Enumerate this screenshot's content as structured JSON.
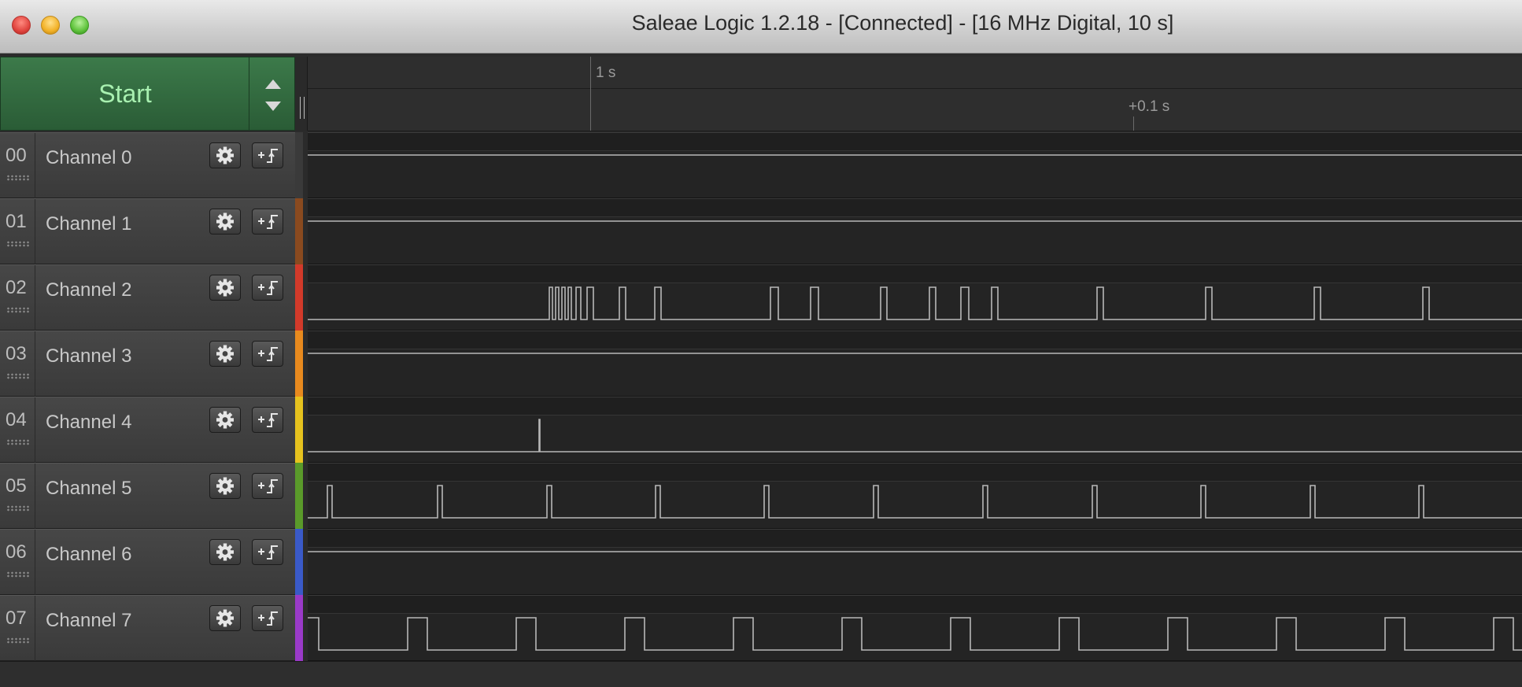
{
  "window": {
    "title": "Saleae Logic 1.2.18 - [Connected] - [16 MHz Digital, 10 s]"
  },
  "start_button": {
    "label": "Start"
  },
  "ruler": {
    "labels": [
      "1 s",
      "+0.1 s"
    ]
  },
  "channels": [
    {
      "index": "00",
      "name": "Channel 0",
      "color": "#3a3a3a",
      "level": "high",
      "edges": []
    },
    {
      "index": "01",
      "name": "Channel 1",
      "color": "#8a4a1f",
      "level": "high",
      "edges": []
    },
    {
      "index": "02",
      "name": "Channel 2",
      "color": "#d23a2a",
      "level": "low",
      "edges": [
        307,
        311,
        315,
        319,
        323,
        327,
        331,
        335,
        341,
        347,
        355,
        363,
        396,
        404,
        441,
        449,
        588,
        598,
        639,
        649,
        728,
        736,
        790,
        798,
        830,
        840,
        869,
        877,
        1003,
        1011,
        1141,
        1149,
        1279,
        1287,
        1417,
        1425
      ]
    },
    {
      "index": "03",
      "name": "Channel 3",
      "color": "#e88a1e",
      "level": "high",
      "edges": []
    },
    {
      "index": "04",
      "name": "Channel 4",
      "color": "#e6c21e",
      "level": "low",
      "edges": [
        294,
        295
      ]
    },
    {
      "index": "05",
      "name": "Channel 5",
      "color": "#5a9a2a",
      "level": "low",
      "edges": [
        25,
        31,
        165,
        171,
        304,
        310,
        442,
        448,
        580,
        586,
        719,
        725,
        858,
        864,
        997,
        1003,
        1135,
        1141,
        1274,
        1280,
        1412,
        1418
      ]
    },
    {
      "index": "06",
      "name": "Channel 6",
      "color": "#3a5ac8",
      "level": "high",
      "edges": []
    },
    {
      "index": "07",
      "name": "Channel 7",
      "color": "#9a3ac8",
      "level": "high",
      "edges": [
        14,
        127,
        152,
        265,
        290,
        403,
        428,
        541,
        566,
        679,
        704,
        817,
        842,
        955,
        980,
        1093,
        1118,
        1231,
        1256,
        1369,
        1394,
        1507,
        1532
      ]
    }
  ],
  "colors": {
    "waveform": "#b8b8b8",
    "start_green": "#2f6a3c"
  }
}
